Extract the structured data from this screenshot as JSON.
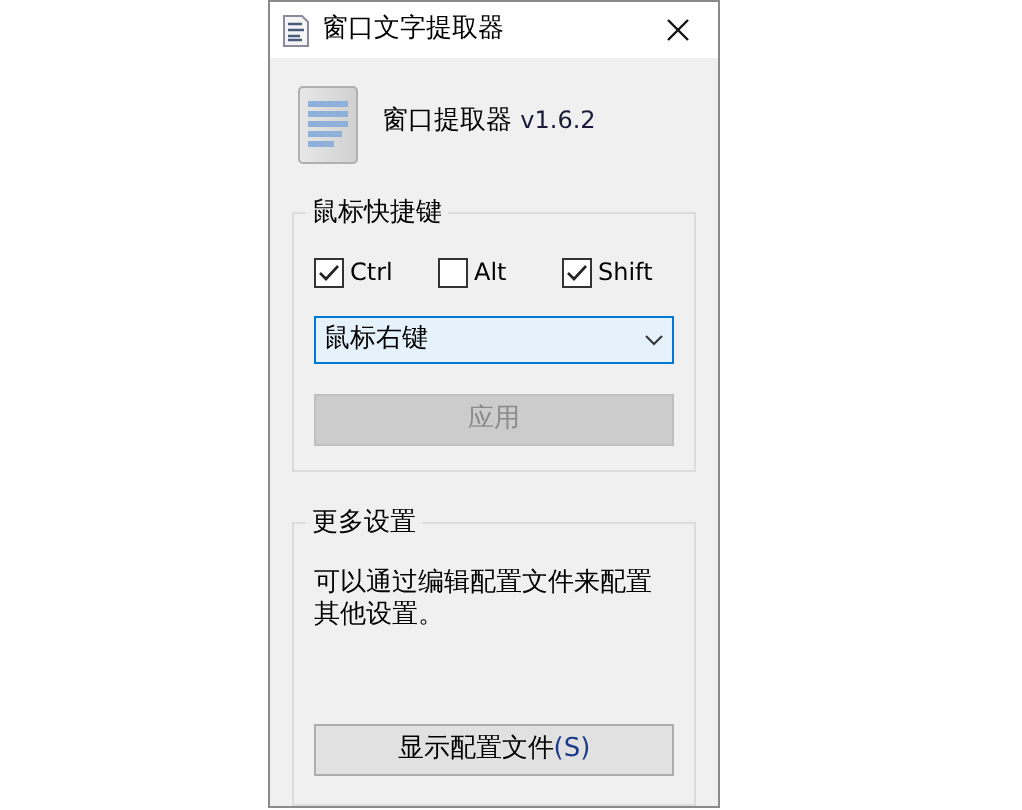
{
  "window": {
    "title": "窗口文字提取器"
  },
  "header": {
    "app_name": "窗口提取器",
    "version": "v1.6.2"
  },
  "hotkey_group": {
    "title": "鼠标快捷键",
    "modifiers": [
      {
        "label": "Ctrl",
        "checked": true
      },
      {
        "label": "Alt",
        "checked": false
      },
      {
        "label": "Shift",
        "checked": true
      }
    ],
    "mouse_button": {
      "value": "鼠标右键",
      "focused": true
    },
    "apply_button": {
      "label": "应用",
      "disabled": true
    }
  },
  "more_group": {
    "title": "更多设置",
    "description": "可以通过编辑配置文件来配置其他设置。",
    "button": {
      "label": "显示配置文件",
      "accesskey": "(S)"
    }
  }
}
